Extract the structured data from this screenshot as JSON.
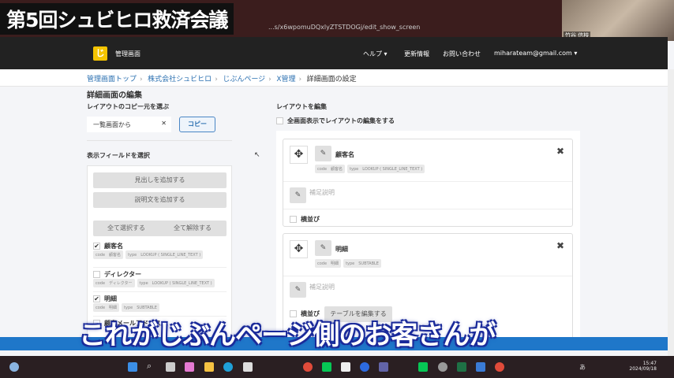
{
  "overlay": {
    "title": "第5回シュビヒロ救済会議",
    "subtitle": "これがじぶんページ側のお客さんが",
    "cam_name": "竹谷 信枝"
  },
  "browser": {
    "url": "...s/x6wpomuDQxlyZTSTDOGj/edit_show_screen"
  },
  "nav": {
    "logo_char": "じ",
    "logo_text": "管理画面",
    "help": "ヘルプ ▾",
    "updates": "更新情報",
    "contact": "お問い合わせ",
    "user": "miharateam@gmail.com ▾"
  },
  "breadcrumb": [
    "管理画面トップ",
    "株式会社シュビヒロ",
    "じぶんページ",
    "X管理",
    "詳細画面の設定"
  ],
  "left": {
    "heading": "詳細画面の編集",
    "copy_label": "レイアウトのコピー元を選ぶ",
    "copy_select": "一覧画面から",
    "copy_button": "コピー",
    "fields_label": "表示フィールドを選択",
    "add_heading": "見出しを追加する",
    "add_desc": "説明文を追加する",
    "select_all": "全て選択する",
    "deselect_all": "全て解除する",
    "fields": [
      {
        "name": "顧客名",
        "checked": true,
        "code": "code　顧客名",
        "type": "type　LOOKUP ( SINGLE_LINE_TEXT )"
      },
      {
        "name": "ディレクター",
        "checked": false,
        "code": "code　ディレクター",
        "type": "type　LOOKUP ( SINGLE_LINE_TEXT )"
      },
      {
        "name": "明細",
        "checked": true,
        "code": "code　明細",
        "type": "type　SUBTABLE"
      },
      {
        "name": "顧客メールアドレス",
        "checked": false
      }
    ]
  },
  "right": {
    "heading": "レイアウトを編集",
    "fullscreen": "全画面表示でレイアウトの編集をする",
    "cards": [
      {
        "name": "顧客名",
        "code": "code　顧客名",
        "type": "type　LOOKUP ( SINGLE_LINE_TEXT )",
        "note": "補足説明",
        "inline": "横並び"
      },
      {
        "name": "明細",
        "code": "code　明細",
        "type": "type　SUBTABLE",
        "note": "補足説明",
        "inline": "横並び",
        "table_button": "テーブルを編集する"
      }
    ]
  },
  "taskbar": {
    "time": "15:47",
    "date": "2024/09/18",
    "ime": "あ"
  },
  "colors": {
    "link": "#2a6fb0",
    "nav": "#222222",
    "accent": "#1f77c9",
    "logo": "#f5c400"
  }
}
